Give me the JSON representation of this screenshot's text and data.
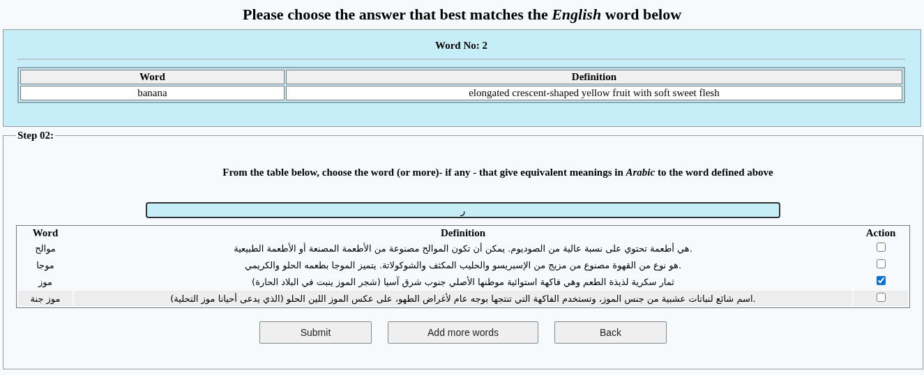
{
  "title": "Please choose the answer that best matches the *English* word below",
  "word_panel": {
    "heading": "Word No: 2",
    "word_header": "Word",
    "definition_header": "Definition",
    "row": {
      "word": "banana",
      "definition": "elongated crescent-shaped yellow fruit with soft sweet flesh"
    }
  },
  "step": {
    "legend": "Step 02:",
    "instruction": "From the table below, choose the word (or more)- if any - that give equivalent meanings in *Arabic* to the word defined above",
    "answer_field": {
      "value": "ر"
    },
    "table": {
      "word_header": "Word",
      "definition_header": "Definition",
      "action_header": "Action",
      "rows": [
        {
          "word": "موالح",
          "definition": "هي أطعمة تحتوي على نسبة عالية من الصوديوم. يمكن أن تكون الموالح مصنوعة من الأطعمة المصنعة أو الأطعمة الطبيعية.",
          "checked": false,
          "hovered": false
        },
        {
          "word": "موجا",
          "definition": "هو نوع من القهوة مصنوع من مزيج من الإسبريسو والحليب المكثف والشوكولاتة. يتميز الموجا بطعمه الحلو والكريمي.",
          "checked": false,
          "hovered": false
        },
        {
          "word": "موز",
          "definition": "ثمار سكرية لذيذة الطعم وهي فاكهة استوائية موطنها الأصلي جنوب شرق آسيا (شجر الموز ينبت في البلاد الحارة)",
          "checked": true,
          "hovered": false
        },
        {
          "word": "موز جنة",
          "definition": "اسم شائع لنباتات عشبية من جنس الموز، وتستخدم الفاكهة التي تنتجها بوجه عام لأغراض الطهو، على عكس الموز اللين الحلو (الذي يدعى أحيانا موز التحلية).",
          "checked": false,
          "hovered": true
        }
      ]
    },
    "submit_button": "Submit",
    "add_words_button": "Add more words",
    "back_button": "Back"
  }
}
